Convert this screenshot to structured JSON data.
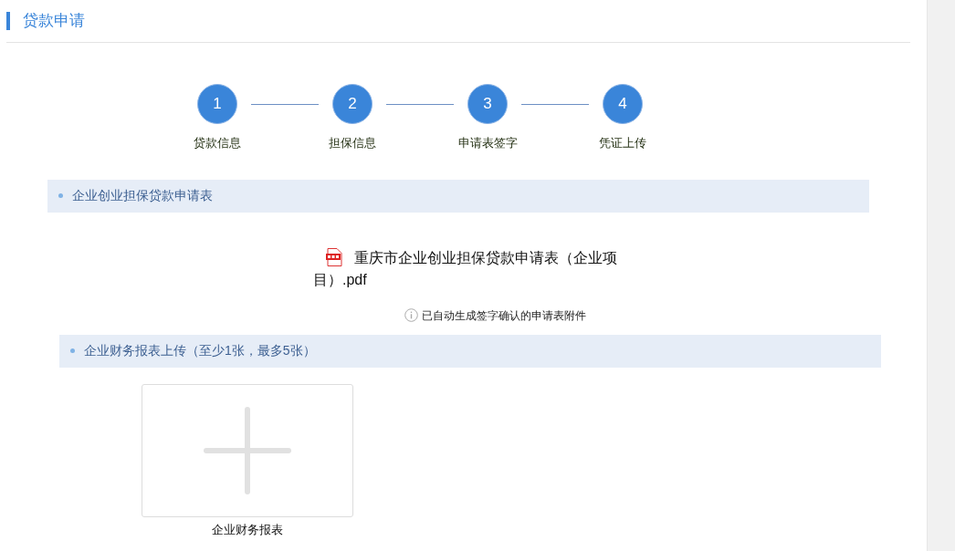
{
  "page_title": "贷款申请",
  "steps": [
    {
      "number": "1",
      "label": "贷款信息"
    },
    {
      "number": "2",
      "label": "担保信息"
    },
    {
      "number": "3",
      "label": "申请表签字"
    },
    {
      "number": "4",
      "label": "凭证上传"
    }
  ],
  "sections": [
    {
      "title": "企业创业担保贷款申请表",
      "file_name": "重庆市企业创业担保贷款申请表（企业项目）.pdf",
      "note": "已自动生成签字确认的申请表附件"
    },
    {
      "title": "企业财务报表上传（至少1张，最多5张）",
      "upload_label": "企业财务报表"
    }
  ]
}
